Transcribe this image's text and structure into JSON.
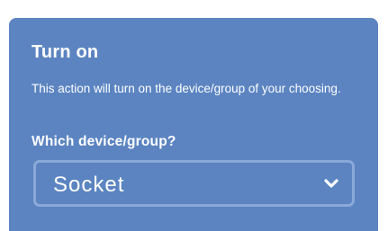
{
  "action": {
    "title": "Turn on",
    "description": "This action will turn on the device/group of your choosing.",
    "field_label": "Which device/group?",
    "selected_device": "Socket",
    "dropdown_icon": "chevron-down-icon"
  },
  "colors": {
    "card_background": "#5b84c1",
    "select_border": "#8aa9d6",
    "text": "#ffffff"
  }
}
